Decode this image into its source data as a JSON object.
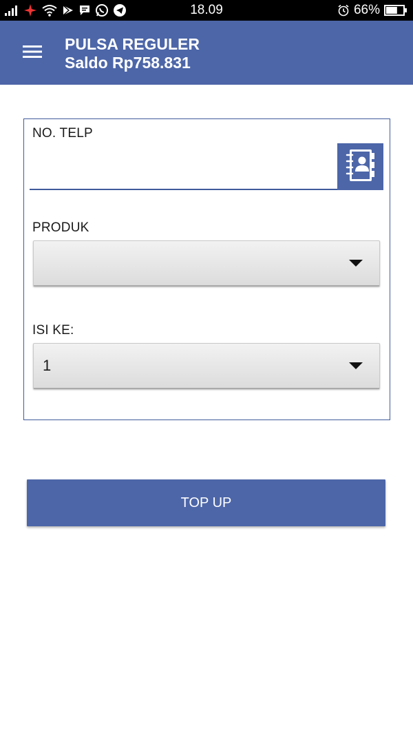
{
  "status_bar": {
    "time": "18.09",
    "battery_percent": "66%",
    "battery_level": 0.66,
    "icons": [
      "signal-icon",
      "notification-icon",
      "wifi-icon",
      "play-store-icon",
      "message-icon",
      "whatsapp-icon",
      "telegram-icon",
      "alarm-icon",
      "battery-icon"
    ]
  },
  "app_bar": {
    "title": "PULSA REGULER",
    "subtitle": "Saldo Rp758.831",
    "accent_color": "#4d66a8"
  },
  "form": {
    "phone": {
      "label": "NO. TELP",
      "value": "",
      "placeholder": ""
    },
    "product": {
      "label": "PRODUK",
      "value": ""
    },
    "fill_to": {
      "label": "ISI KE:",
      "value": "1"
    }
  },
  "actions": {
    "topup_label": "TOP UP"
  }
}
